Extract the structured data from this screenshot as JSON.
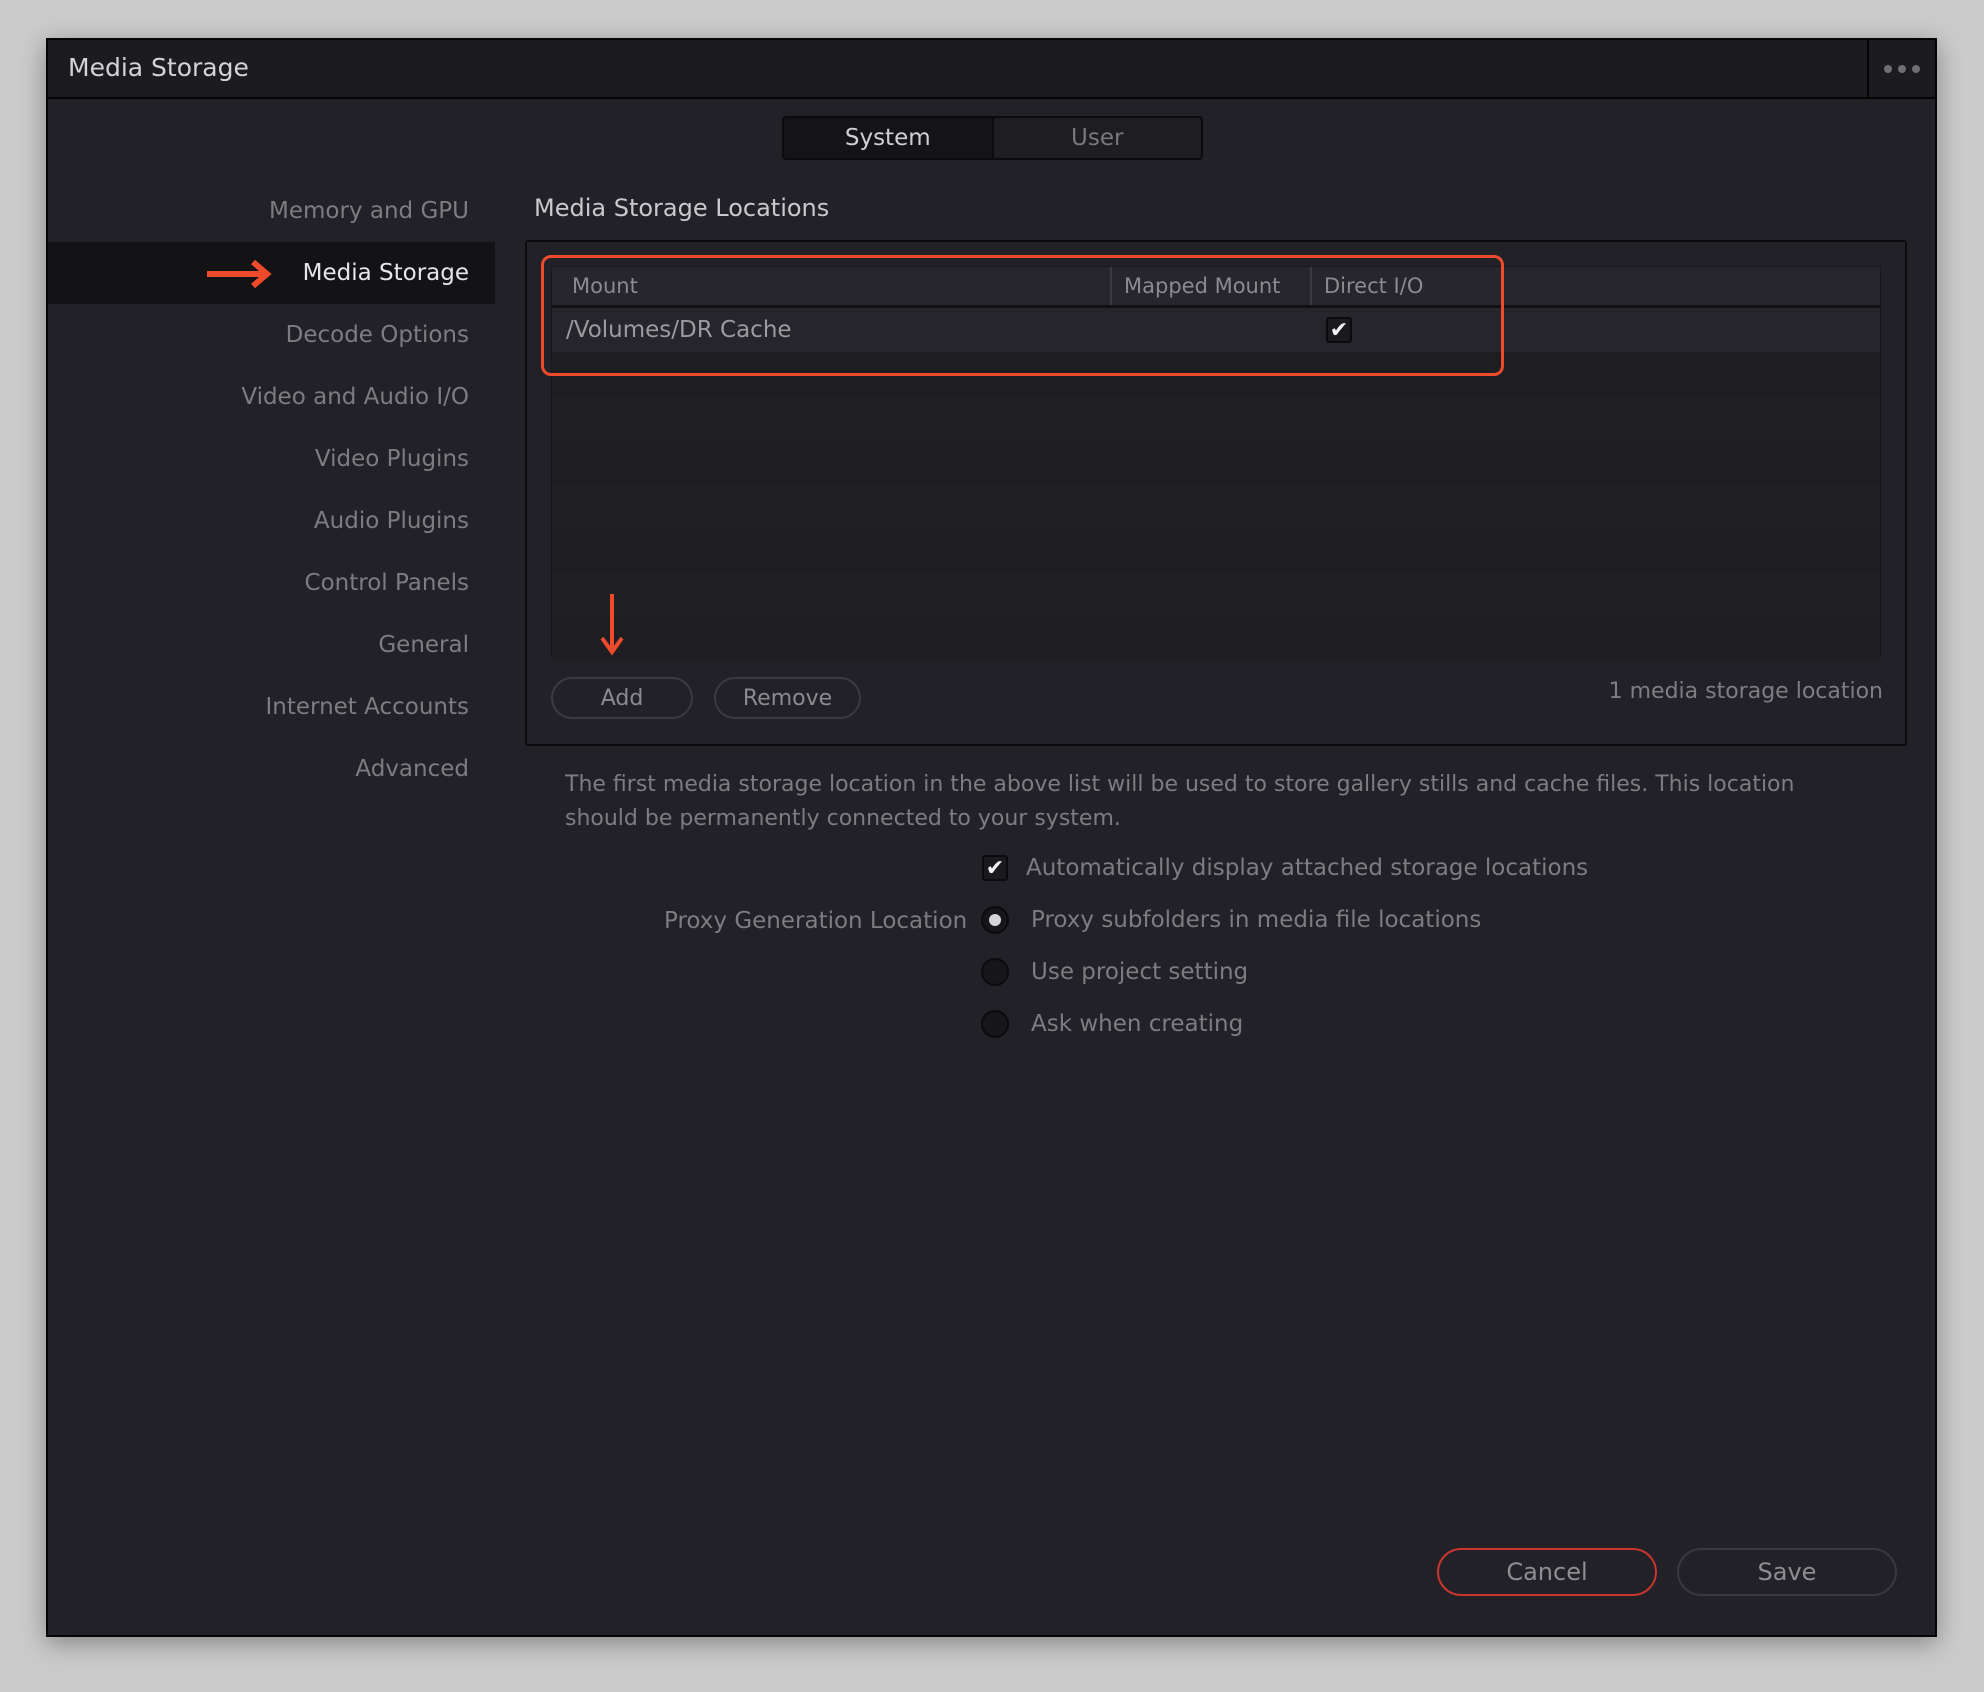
{
  "window": {
    "title": "Media Storage",
    "menu_icon": "more-horizontal-icon"
  },
  "tabs": [
    {
      "label": "System",
      "active": true
    },
    {
      "label": "User",
      "active": false
    }
  ],
  "sidebar": {
    "items": [
      {
        "label": "Memory and GPU",
        "active": false
      },
      {
        "label": "Media Storage",
        "active": true
      },
      {
        "label": "Decode Options",
        "active": false
      },
      {
        "label": "Video and Audio I/O",
        "active": false
      },
      {
        "label": "Video Plugins",
        "active": false
      },
      {
        "label": "Audio Plugins",
        "active": false
      },
      {
        "label": "Control Panels",
        "active": false
      },
      {
        "label": "General",
        "active": false
      },
      {
        "label": "Internet Accounts",
        "active": false
      },
      {
        "label": "Advanced",
        "active": false
      }
    ]
  },
  "main": {
    "section_title": "Media Storage Locations",
    "table": {
      "columns": [
        "Mount",
        "Mapped Mount",
        "Direct I/O"
      ],
      "rows": [
        {
          "mount": "/Volumes/DR Cache",
          "mapped_mount": "",
          "direct_io": true
        }
      ]
    },
    "add_label": "Add",
    "remove_label": "Remove",
    "count_label": "1 media storage location",
    "description": "The first media storage location in the above list will be used to store gallery stills and cache files. This location should be permanently connected to your system.",
    "auto_display": {
      "label": "Automatically display attached storage locations",
      "checked": true
    },
    "proxy": {
      "label": "Proxy Generation Location",
      "options": [
        {
          "label": "Proxy subfolders in media file locations",
          "selected": true
        },
        {
          "label": "Use project setting",
          "selected": false
        },
        {
          "label": "Ask when creating",
          "selected": false
        }
      ]
    }
  },
  "footer": {
    "cancel_label": "Cancel",
    "save_label": "Save"
  },
  "annotations": {
    "color": "#ee4a2c",
    "arrow_sidebar": "arrow-right-icon",
    "arrow_add": "arrow-down-icon"
  },
  "colors": {
    "background": "#212127",
    "titlebar": "#1b1b20",
    "cancel_border": "#c8362f"
  }
}
